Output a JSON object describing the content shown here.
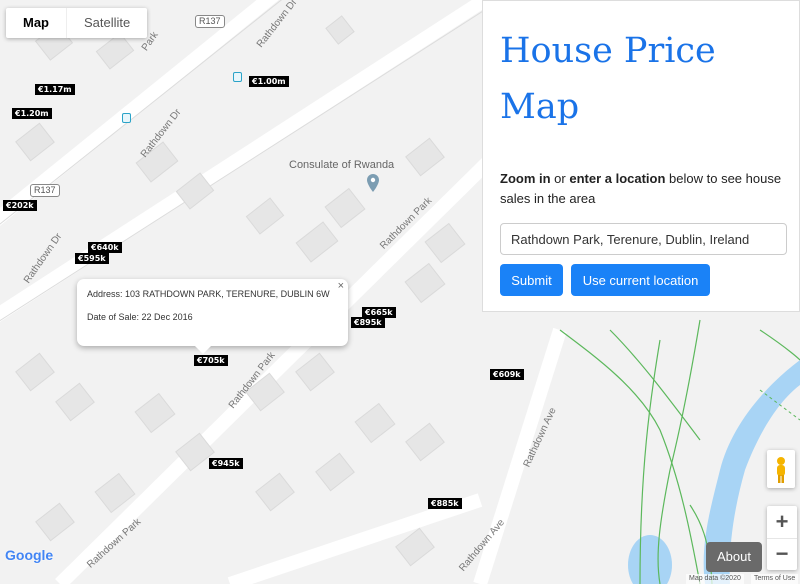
{
  "map_type": {
    "map": "Map",
    "satellite": "Satellite"
  },
  "road_labels": {
    "rathdown_dr_1": "Rathdown Dr",
    "rathdown_dr_2": "Rathdown Dr",
    "rathdown_dr_3": "Rathdown Dr",
    "rathdown_park_1": "Park",
    "rathdown_park_2": "Rathdown Park",
    "rathdown_park_3": "Rathdown Park",
    "rathdown_park_4": "Rathdown Park",
    "rathdown_ave_1": "Rathdown Ave",
    "rathdown_ave_2": "Rathdown Ave",
    "r137_a": "R137",
    "r137_b": "R137"
  },
  "poi": {
    "consulate": "Consulate of Rwanda"
  },
  "prices": [
    "€1.00m",
    "€1.17m",
    "€1.20m",
    "€202k",
    "€640k",
    "€595k",
    "€665k",
    "€895k",
    "€705k",
    "€609k",
    "€945k",
    "€885k"
  ],
  "info_window": {
    "address_label": "Address:",
    "address": "103 RATHDOWN PARK, TERENURE, DUBLIN 6W",
    "date_label": "Date of Sale:",
    "date": "22 Dec 2016",
    "close": "×"
  },
  "panel": {
    "title_line1": "House Price",
    "title_line2": "Map",
    "intro_b1": "Zoom in",
    "intro_t1": " or ",
    "intro_b2": "enter a location",
    "intro_t2": " below to see house sales in the area",
    "location_value": "Rathdown Park, Terenure, Dublin, Ireland",
    "submit": "Submit",
    "use_location": "Use current location"
  },
  "controls": {
    "zoom_in": "+",
    "zoom_out": "−",
    "about": "About"
  },
  "attribution": {
    "google": "Google",
    "map_data": "Map data ©2020",
    "terms": "Terms of Use"
  },
  "colors": {
    "accent": "#1a73e8",
    "button": "#1a82f7",
    "water": "#a8d4f5",
    "path": "#5cb85c"
  }
}
